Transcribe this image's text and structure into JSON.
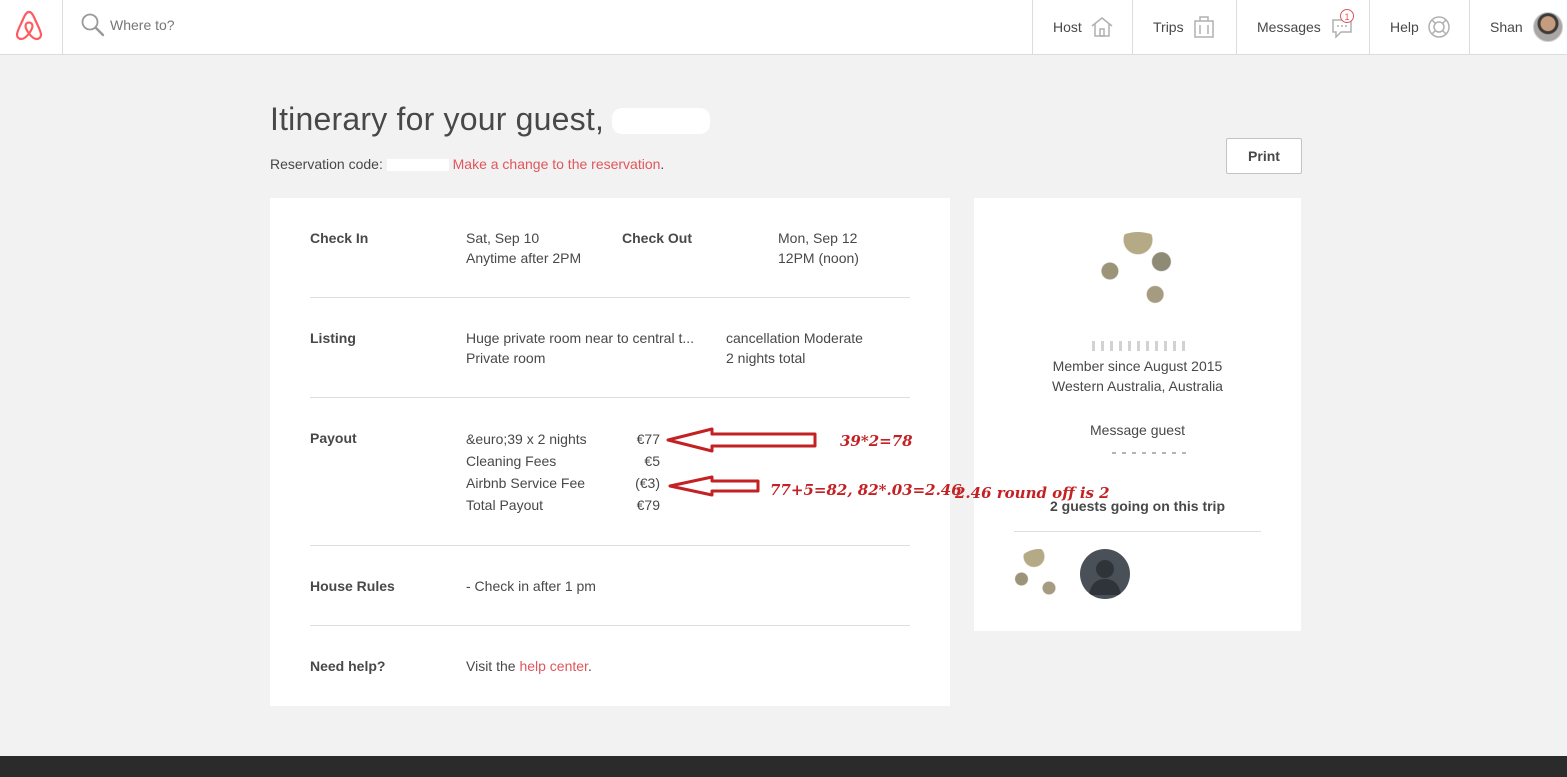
{
  "header": {
    "search_placeholder": "Where to?",
    "nav": {
      "host": "Host",
      "trips": "Trips",
      "messages": "Messages",
      "messages_badge": "1",
      "help": "Help",
      "user": "Shan"
    }
  },
  "page": {
    "title": "Itinerary for your guest,",
    "reservation_label": "Reservation code:",
    "change_link": "Make a change to the reservation",
    "change_suffix": ".",
    "print_button": "Print"
  },
  "details": {
    "checkin_label": "Check In",
    "checkin_date": "Sat, Sep 10",
    "checkin_time": "Anytime after 2PM",
    "checkout_label": "Check Out",
    "checkout_date": "Mon, Sep 12",
    "checkout_time": "12PM (noon)",
    "listing_label": "Listing",
    "listing_title": "Huge private room near to central t...",
    "listing_type": "Private room",
    "cancellation": "cancellation Moderate",
    "nights_total": "2 nights total",
    "payout_label": "Payout",
    "payout_rows": [
      {
        "label": "&euro;39 x 2 nights",
        "amount": "€77"
      },
      {
        "label": "Cleaning Fees",
        "amount": "€5"
      },
      {
        "label": "Airbnb Service Fee",
        "amount": "(€3)"
      },
      {
        "label": "Total Payout",
        "amount": "€79"
      }
    ],
    "house_rules_label": "House Rules",
    "house_rules": "- Check in after 1 pm",
    "help_label": "Need help?",
    "help_prefix": "Visit the",
    "help_link": "help center",
    "help_suffix": "."
  },
  "guest_card": {
    "member_since": "Member since August 2015",
    "location": "Western Australia, Australia",
    "message_link": "Message guest",
    "guests_going": "2 guests going on this trip"
  },
  "annotations": {
    "note_1": "39*2=78",
    "note_2": "77+5=82, 82*.03=2.46",
    "note_3": "2.46 round off is 2"
  },
  "colors": {
    "accent": "#e0565b",
    "annotation": "#c32124",
    "footer": "#2b2b2b"
  }
}
